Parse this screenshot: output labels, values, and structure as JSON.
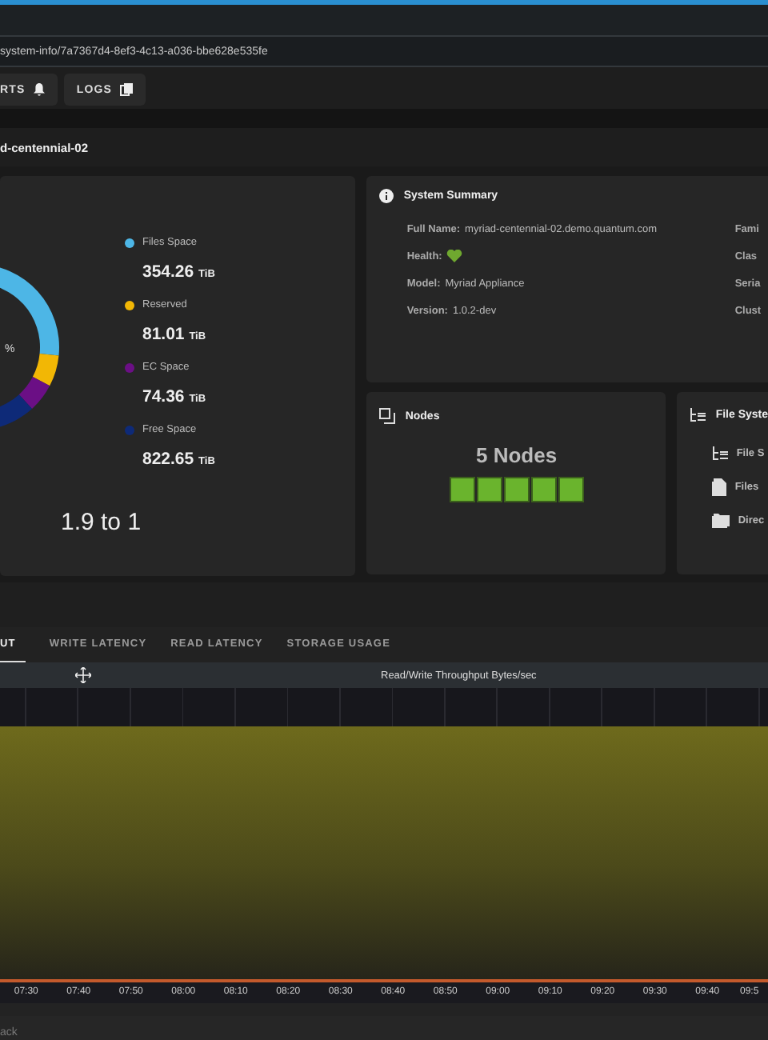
{
  "address_bar": {
    "value": "system-info/7a7367d4-8ef3-4c13-a036-bbe628e535fe"
  },
  "toolbar": [
    {
      "label": "RTS"
    },
    {
      "label": "LOGS"
    }
  ],
  "page_title": "d-centennial-02",
  "capacity": {
    "center_text": "%",
    "legend": [
      {
        "label": "Files Space",
        "value": "354.26",
        "unit": "TiB",
        "color": "#4db6e6"
      },
      {
        "label": "Reserved",
        "value": "81.01",
        "unit": "TiB",
        "color": "#f2b705"
      },
      {
        "label": "EC Space",
        "value": "74.36",
        "unit": "TiB",
        "color": "#6b0f85"
      },
      {
        "label": "Free Space",
        "value": "822.65",
        "unit": "TiB",
        "color": "#0e2a78"
      }
    ],
    "ratio": "1.9 to 1"
  },
  "system_summary": {
    "title": "System Summary",
    "fields": [
      {
        "kind": "text",
        "label": "Full Name:",
        "value": "myriad-centennial-02.demo.quantum.com"
      },
      {
        "kind": "heart",
        "label": "Health:"
      },
      {
        "kind": "text",
        "label": "Model:",
        "value": "Myriad Appliance"
      },
      {
        "kind": "text",
        "label": "Version:",
        "value": "1.0.2-dev"
      }
    ],
    "column_2_labels": [
      "Fami",
      "Clas",
      "Seria",
      "Clust"
    ]
  },
  "nodes": {
    "title": "Nodes",
    "count": "5 Nodes",
    "blocks": [
      {
        "healthy": true
      },
      {
        "healthy": true
      },
      {
        "healthy": true
      },
      {
        "healthy": true
      },
      {
        "healthy": true
      }
    ]
  },
  "file_system": {
    "title": "File Syste",
    "items": [
      {
        "kind": "tree",
        "label": "File S"
      },
      {
        "kind": "file",
        "label": "Files"
      },
      {
        "kind": "folder",
        "label": "Direc"
      }
    ]
  },
  "tabs": [
    {
      "label": "UT",
      "selected": true
    },
    {
      "label": "WRITE LATENCY",
      "selected": false
    },
    {
      "label": "READ LATENCY",
      "selected": false
    },
    {
      "label": "STORAGE USAGE",
      "selected": false
    }
  ],
  "chart": {
    "title": "Read/Write Throughput Bytes/sec",
    "x_labels": [
      "07:30",
      "07:40",
      "07:50",
      "08:00",
      "08:10",
      "08:20",
      "08:30",
      "08:40",
      "08:50",
      "09:00",
      "09:10",
      "09:20",
      "09:30",
      "09:40",
      "09:5"
    ]
  },
  "footer": {
    "text": "ack"
  }
}
